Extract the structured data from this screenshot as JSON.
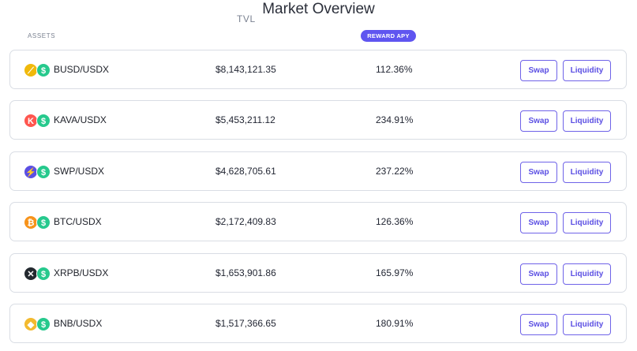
{
  "title": "Market Overview",
  "headers": {
    "assets": "ASSETS",
    "tvl": "TVL",
    "apy": "REWARD APY"
  },
  "colors": {
    "accent": "#5f55f0",
    "usdx": "#26c98d"
  },
  "rows": [
    {
      "pair": "BUSD/USDX",
      "tvl": "$8,143,121.35",
      "apy": "112.36%",
      "icon": "busd-icon",
      "icon_color": "#f0b90b",
      "icon_glyph": "⟋",
      "swap": "Swap",
      "liquidity": "Liquidity"
    },
    {
      "pair": "KAVA/USDX",
      "tvl": "$5,453,211.12",
      "apy": "234.91%",
      "icon": "kava-icon",
      "icon_color": "#ff564f",
      "icon_glyph": "K",
      "swap": "Swap",
      "liquidity": "Liquidity"
    },
    {
      "pair": "SWP/USDX",
      "tvl": "$4,628,705.61",
      "apy": "237.22%",
      "icon": "swp-icon",
      "icon_color": "#5b4fe3",
      "icon_glyph": "⚡",
      "swap": "Swap",
      "liquidity": "Liquidity"
    },
    {
      "pair": "BTC/USDX",
      "tvl": "$2,172,409.83",
      "apy": "126.36%",
      "icon": "btc-icon",
      "icon_color": "#f7931a",
      "icon_glyph": "₿",
      "swap": "Swap",
      "liquidity": "Liquidity"
    },
    {
      "pair": "XRPB/USDX",
      "tvl": "$1,653,901.86",
      "apy": "165.97%",
      "icon": "xrp-icon",
      "icon_color": "#23292f",
      "icon_glyph": "✕",
      "swap": "Swap",
      "liquidity": "Liquidity"
    },
    {
      "pair": "BNB/USDX",
      "tvl": "$1,517,366.65",
      "apy": "180.91%",
      "icon": "bnb-icon",
      "icon_color": "#f3ba2f",
      "icon_glyph": "◆",
      "swap": "Swap",
      "liquidity": "Liquidity"
    }
  ],
  "usdx_glyph": "$"
}
